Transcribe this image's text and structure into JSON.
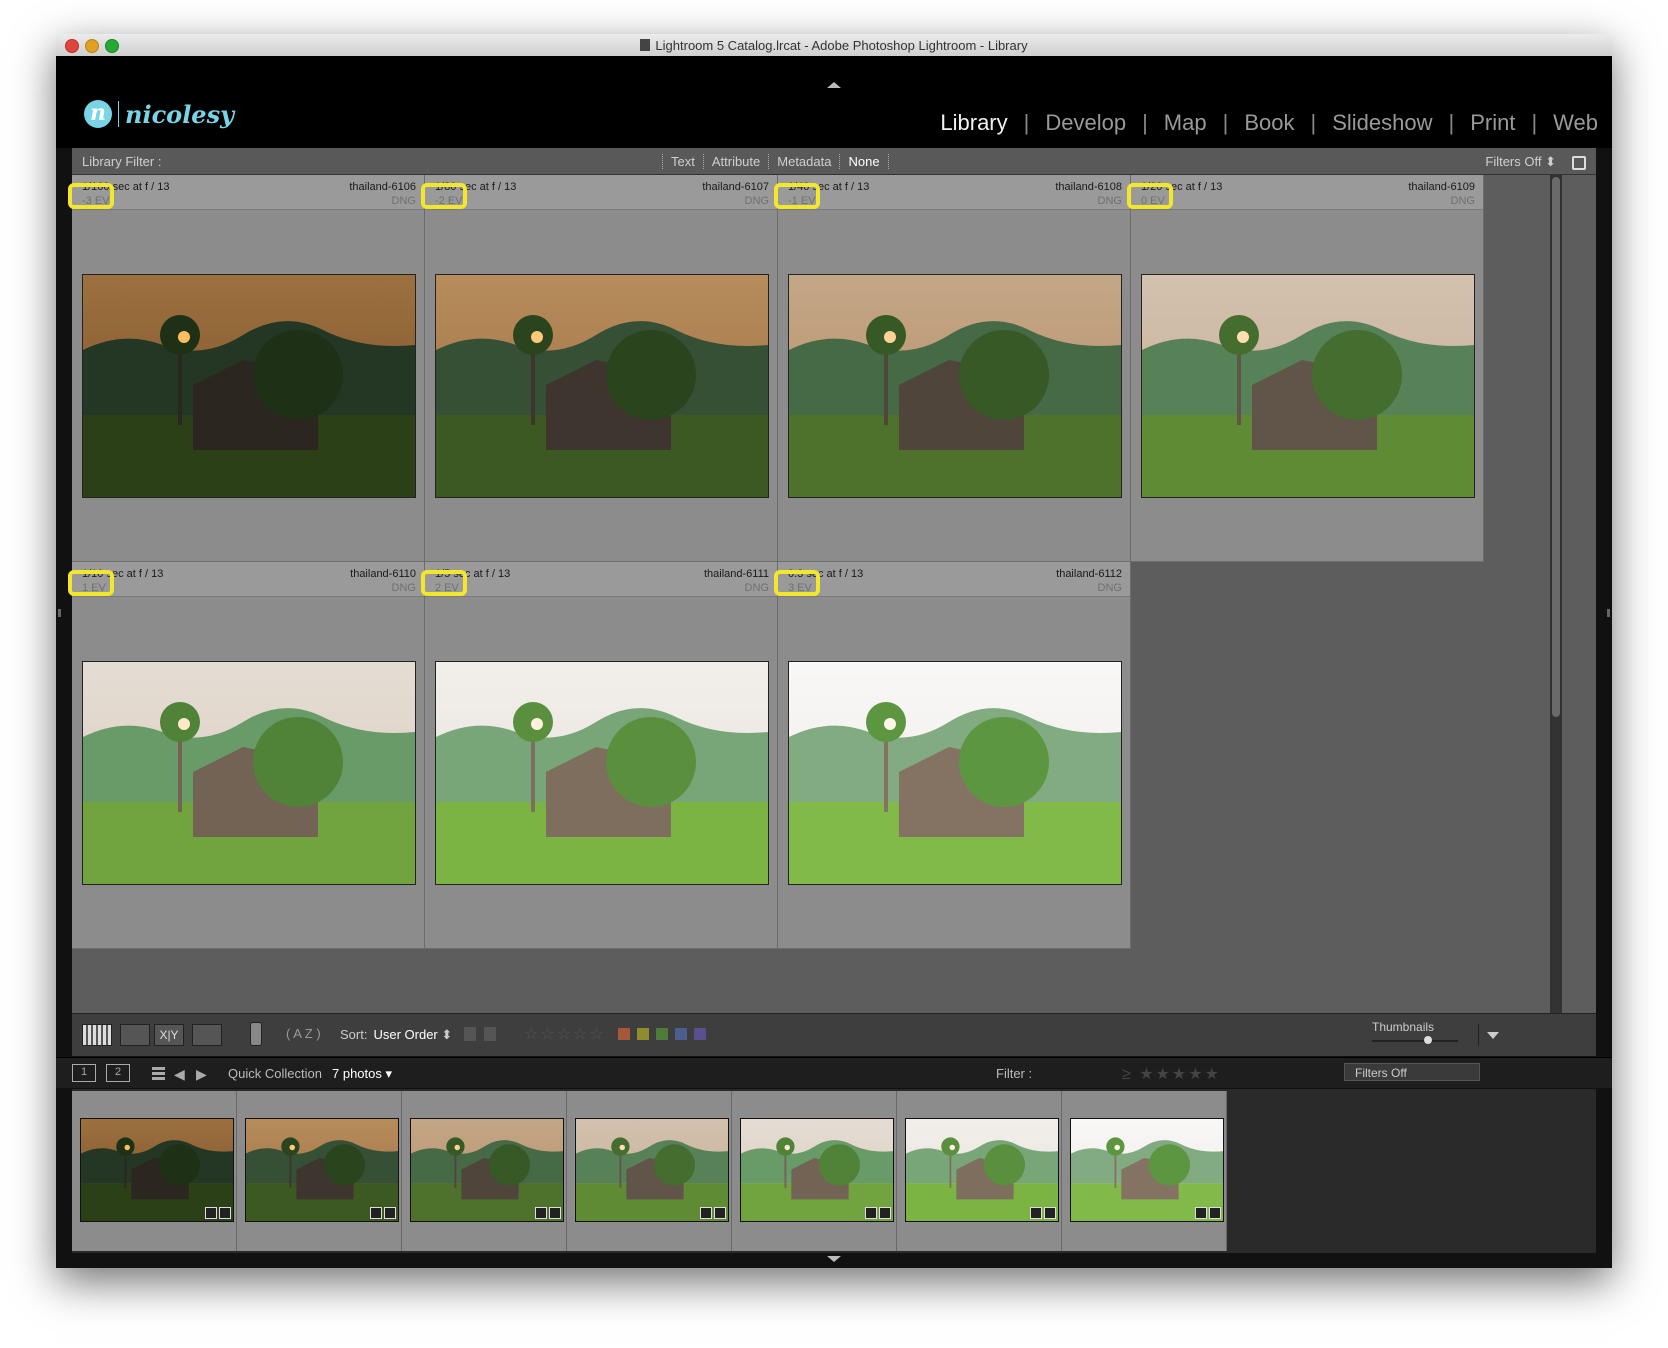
{
  "window": {
    "title": "Lightroom 5 Catalog.lrcat - Adobe Photoshop Lightroom - Library"
  },
  "brand": {
    "logo_letter": "n",
    "logo_text": "nicolesy"
  },
  "modules": [
    {
      "label": "Library",
      "active": true
    },
    {
      "label": "Develop",
      "active": false
    },
    {
      "label": "Map",
      "active": false
    },
    {
      "label": "Book",
      "active": false
    },
    {
      "label": "Slideshow",
      "active": false
    },
    {
      "label": "Print",
      "active": false
    },
    {
      "label": "Web",
      "active": false
    }
  ],
  "library_filter": {
    "label": "Library Filter :",
    "options": [
      "Text",
      "Attribute",
      "Metadata",
      "None"
    ],
    "active": "None",
    "preset": "Filters Off"
  },
  "grid": {
    "photos": [
      {
        "exposure": "1/160 sec at f / 13",
        "ev": "-3 EV",
        "filename": "thailand-6106",
        "filetype": "DNG",
        "brightness": 0.25
      },
      {
        "exposure": "1/80 sec at f / 13",
        "ev": "-2 EV",
        "filename": "thailand-6107",
        "filetype": "DNG",
        "brightness": 0.4
      },
      {
        "exposure": "1/40 sec at f / 13",
        "ev": "-1 EV",
        "filename": "thailand-6108",
        "filetype": "DNG",
        "brightness": 0.55
      },
      {
        "exposure": "1/20 sec at f / 13",
        "ev": "0 EV",
        "filename": "thailand-6109",
        "filetype": "DNG",
        "brightness": 0.7
      },
      {
        "exposure": "1/10 sec at f / 13",
        "ev": "1 EV",
        "filename": "thailand-6110",
        "filetype": "DNG",
        "brightness": 0.85
      },
      {
        "exposure": "1/5 sec at f / 13",
        "ev": "2 EV",
        "filename": "thailand-6111",
        "filetype": "DNG",
        "brightness": 0.95
      },
      {
        "exposure": "0.3 sec at f / 13",
        "ev": "3 EV",
        "filename": "thailand-6112",
        "filetype": "DNG",
        "brightness": 1.0
      }
    ]
  },
  "toolbar": {
    "sort_label": "Sort:",
    "sort_value": "User Order",
    "thumbnails_label": "Thumbnails",
    "thumbnail_size": 0.65,
    "color_labels": [
      "#a5573a",
      "#8d8d2d",
      "#4e7c3a",
      "#4b5f8f",
      "#5a4f8f"
    ]
  },
  "filmstrip_bar": {
    "display_1": "1",
    "display_2": "2",
    "source": "Quick Collection",
    "count": "7 photos",
    "filter_label": "Filter :",
    "filter_preset": "Filters Off"
  },
  "icons": {
    "grid_view": "grid-view-icon",
    "loupe_view": "loupe-view-icon",
    "compare_view": "compare-view-icon",
    "survey_view": "survey-view-icon",
    "spray": "painter-icon",
    "sort_direction": "sort-direction-icon",
    "lock": "lock-icon"
  }
}
